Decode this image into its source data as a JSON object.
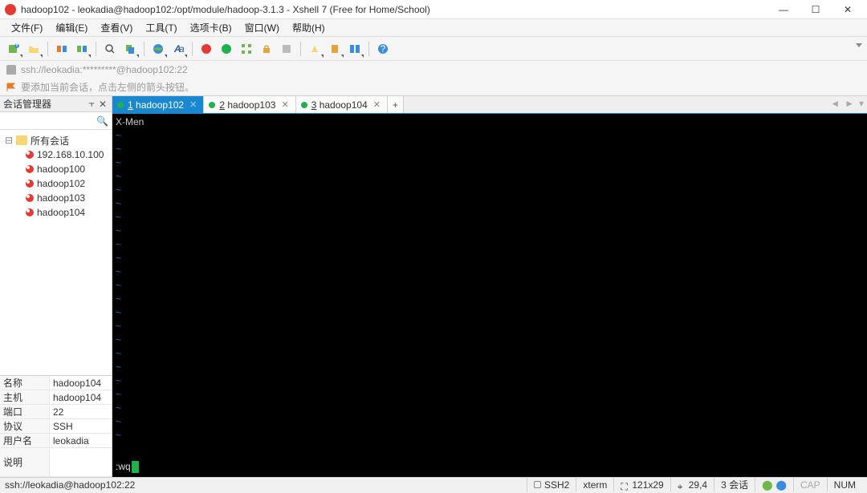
{
  "window": {
    "title": "hadoop102 - leokadia@hadoop102:/opt/module/hadoop-3.1.3 - Xshell 7 (Free for Home/School)"
  },
  "menu": {
    "items": [
      "文件(F)",
      "编辑(E)",
      "查看(V)",
      "工具(T)",
      "选项卡(B)",
      "窗口(W)",
      "帮助(H)"
    ]
  },
  "address": {
    "text": "ssh://leokadia:*********@hadoop102:22"
  },
  "hint": {
    "text": "要添加当前会话，点击左侧的箭头按钮。"
  },
  "sidebar": {
    "title": "会话管理器",
    "root": "所有会话",
    "hosts": [
      "192.168.10.100",
      "hadoop100",
      "hadoop102",
      "hadoop103",
      "hadoop104"
    ]
  },
  "props": {
    "rows": [
      {
        "label": "名称",
        "value": "hadoop104"
      },
      {
        "label": "主机",
        "value": "hadoop104"
      },
      {
        "label": "端口",
        "value": "22"
      },
      {
        "label": "协议",
        "value": "SSH"
      },
      {
        "label": "用户名",
        "value": "leokadia"
      },
      {
        "label": "说明",
        "value": ""
      }
    ]
  },
  "tabs": {
    "items": [
      {
        "num": "1",
        "label": "hadoop102",
        "active": true
      },
      {
        "num": "2",
        "label": "hadoop103",
        "active": false
      },
      {
        "num": "3",
        "label": "hadoop104",
        "active": false
      }
    ],
    "add": "+"
  },
  "terminal": {
    "first_line": "X-Men",
    "tilde": "~",
    "cmd": ":wq"
  },
  "status": {
    "left": "ssh://leokadia@hadoop102:22",
    "ssh": "SSH2",
    "term": "xterm",
    "size": "121x29",
    "pos": "29,4",
    "sess": "3 会话",
    "cap": "CAP",
    "num": "NUM"
  }
}
